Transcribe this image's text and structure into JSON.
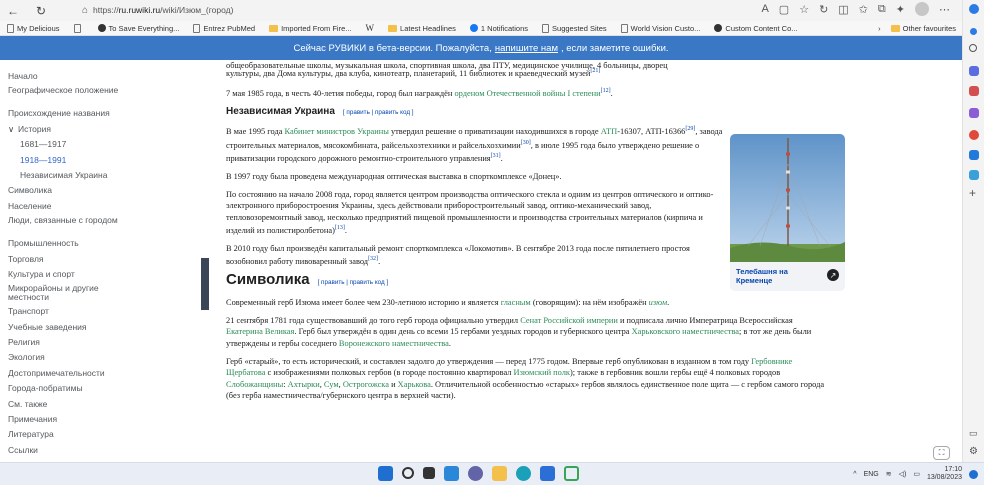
{
  "browser": {
    "url_prefix": "https://",
    "url_host": "ru.ruwiki.ru",
    "url_path": "/wiki/Изюм_(город)",
    "bookmarks": [
      "My Delicious",
      "",
      "To Save Everything...",
      "Entrez PubMed",
      "Imported From Fire...",
      "Latest Headlines",
      "1 Notifications",
      "Suggested Sites",
      "World Vision Custo...",
      "Custom Content Co..."
    ],
    "other_favourites": "Other favourites"
  },
  "banner": {
    "prefix": "Сейчас РУВИКИ в бета-версии. Пожалуйста,",
    "link": "напишите нам",
    "suffix": ", если заметите ошибки."
  },
  "nav": [
    {
      "label": "Начало",
      "level": 0
    },
    {
      "label": "Географическое положение",
      "level": 0
    },
    {
      "label": "Происхождение названия",
      "level": 0
    },
    {
      "label": "История",
      "level": 0,
      "expanded": true
    },
    {
      "label": "1681—1917",
      "level": 1
    },
    {
      "label": "1918—1991",
      "level": 1,
      "active": true
    },
    {
      "label": "Независимая Украина",
      "level": 1
    },
    {
      "label": "Символика",
      "level": 0
    },
    {
      "label": "Население",
      "level": 0
    },
    {
      "label": "Люди, связанные с городом",
      "level": 0
    },
    {
      "label": "Промышленность",
      "level": 0
    },
    {
      "label": "Торговля",
      "level": 0
    },
    {
      "label": "Культура и спорт",
      "level": 0
    },
    {
      "label": "Микрорайоны и другие местности",
      "level": 0
    },
    {
      "label": "Транспорт",
      "level": 0
    },
    {
      "label": "Учебные заведения",
      "level": 0
    },
    {
      "label": "Религия",
      "level": 0
    },
    {
      "label": "Экология",
      "level": 0
    },
    {
      "label": "Достопримечательности",
      "level": 0
    },
    {
      "label": "Города-побратимы",
      "level": 0
    },
    {
      "label": "См. также",
      "level": 0
    },
    {
      "label": "Примечания",
      "level": 0
    },
    {
      "label": "Литература",
      "level": 0
    },
    {
      "label": "Ссылки",
      "level": 0
    }
  ],
  "content": {
    "top_cut": "общеобразовательные школы, музыкальная школа, спортивная школа, два ПТУ, медицинское училище, 4 больницы, дворец",
    "culture_line": "культуры, два Дома культуры, два клуба, кинотеатр, планетарий, 11 библиотек и краеведческий музей",
    "ref21": "[21]",
    "may1985_pre": "7 мая 1985 года, в честь 40-летия победы, город был награждён",
    "may1985_link": "орденом Отечественной войны I степени",
    "ref12": "[12]",
    "h_independent": "Независимая Украина",
    "edit_links": "[ править | править код ]",
    "p1995_a": "В мае 1995 года",
    "p1995_link1": "Кабинет министров Украины",
    "p1995_b": "утвердил решение о приватизации находившихся в городе",
    "p1995_link2": "АТП",
    "p1995_c": "-16307, АТП-16366",
    "ref29": "[29]",
    "p1995_d": ", завода строительных материалов, мясокомбината, райсельхозтехники и райсельхозхимии",
    "ref30": "[30]",
    "p1995_e": ", в июле 1995 года было утверждено решение о приватизации городского дорожного ремонтно-строительного управления",
    "ref31": "[31]",
    "p1997": "В 1997 году была проведена международная оптическая выставка в спорткомплексе «Донец».",
    "p2008": "По состоянию на начало 2008 года, город является центром производства оптического стекла и одним из центров оптического и оптико-электронного приборостроения Украины, здесь действовали приборостроительный завод, оптико-механический завод, тепловозоремонтный завод, несколько предприятий пищевой промышленности и производства строительных материалов (кирпича и изделий из полистиролбетона)",
    "ref13": "[13]",
    "p2010": "В 2010 году был произведён капитальный ремонт спорткомплекса «Локомотив». В сентябре 2013 года после пятилетнего простоя возобновил работу пивоваренный завод",
    "ref32": "[32]",
    "h_symbolics": "Символика",
    "sym1_a": "Современный герб Изюма имеет более чем 230-летнюю историю и является",
    "sym1_link1": "гласным",
    "sym1_b": "(говорящим): на нём изображён",
    "sym1_link2": "изюм",
    "sym1_c": ".",
    "sym2_a": "21 сентября 1781 года существовавший до того герб города официально утвердил",
    "sym2_link1": "Сенат Российской империи",
    "sym2_b": "и подписала лично Императрица Всероссийская",
    "sym2_link2": "Екатерина Великая",
    "sym2_c": ". Герб был утверждён в один день со всеми 15 гербами уездных городов и губернского центра",
    "sym2_link3": "Харьковского наместничества",
    "sym2_d": "; в тот же день были утверждены и гербы соседнего",
    "sym2_link4": "Воронежского наместничества",
    "sym2_e": ".",
    "sym3_a": "Герб «старый», то есть исторический, и составлен задолго до утверждения — перед 1775 годом. Впервые герб опубликован в изданном в том году",
    "sym3_link1": "Гербовнике Щербатова",
    "sym3_b": "с изображениями полковых гербов (в городе постоянно квартировал",
    "sym3_link2": "Изюмский полк",
    "sym3_c": "); также в гербовник вошли гербы ещё 4 полковых городов",
    "sym3_link3": "Слобожанщины",
    "sym3_d": ":",
    "sym3_link4": "Ахтырки",
    "sym3_e": ",",
    "sym3_link5": "Сум",
    "sym3_f": ",",
    "sym3_link6": "Острогожска",
    "sym3_g": "и",
    "sym3_link7": "Харькова",
    "sym3_h": ". Отличительной особенностью «старых» гербов являлось единственное поле щита — с гербом самого города (без герба наместничества/губернского центра в верхней части)."
  },
  "figure": {
    "caption": "Телебашня на Кременце"
  },
  "taskbar": {
    "lang": "ENG",
    "time": "17:10",
    "date": "13/08/2023"
  },
  "colors": {
    "banner": "#3a78c5",
    "link": "#0645ad",
    "green_link": "#2a8b57",
    "taskbar": "#e9eef6"
  }
}
